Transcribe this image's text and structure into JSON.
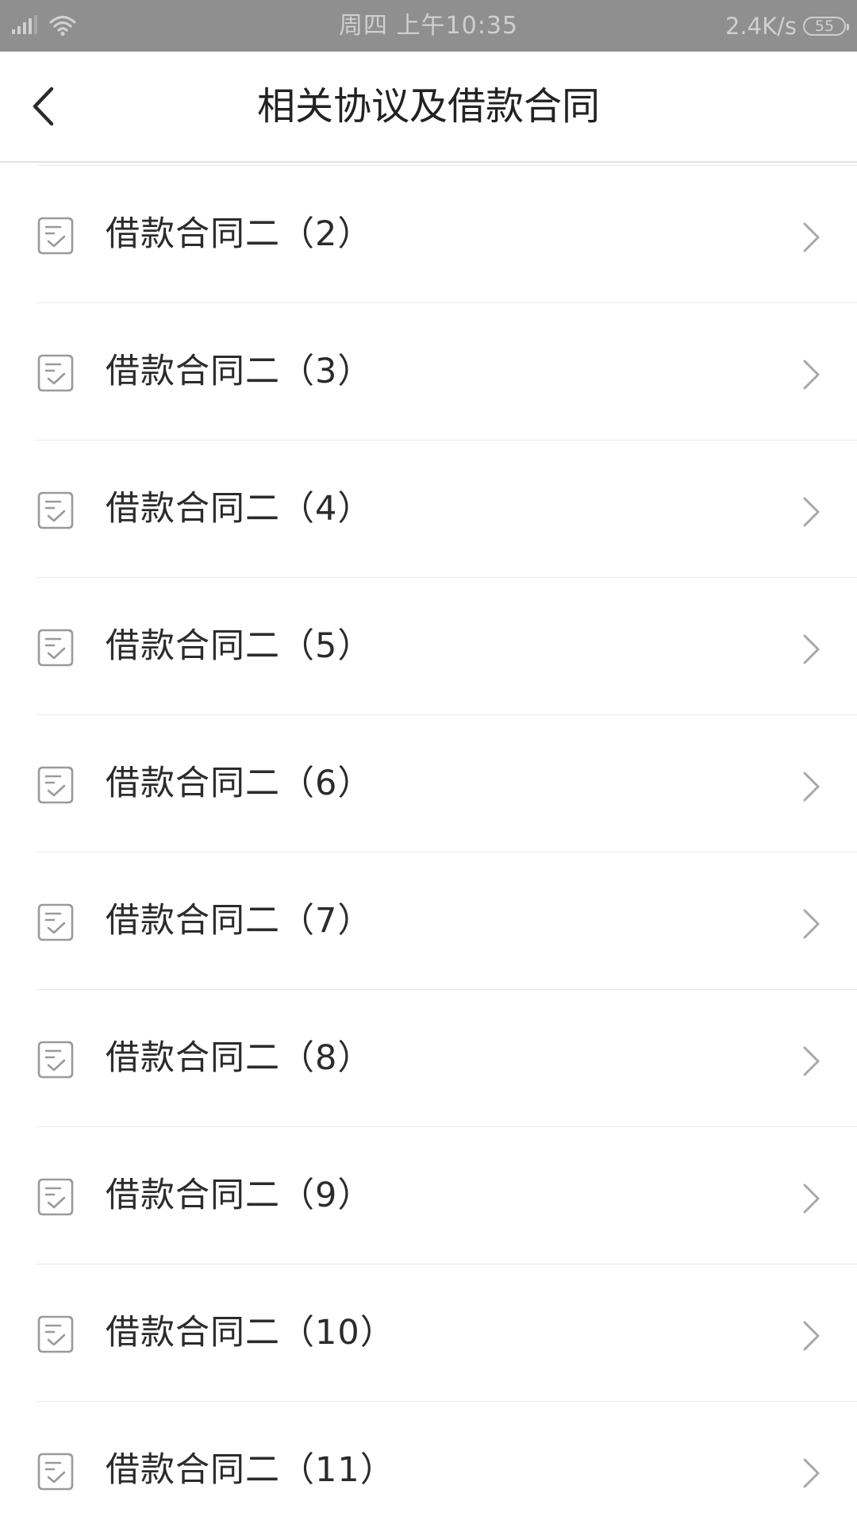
{
  "status_bar": {
    "time": "周四  上午10:35",
    "net_speed": "2.4K/s",
    "battery": "55",
    "icons": [
      "signal-icon",
      "wifi-icon",
      "battery-icon"
    ]
  },
  "header": {
    "title": "相关协议及借款合同",
    "back_icon": "chevron-left-icon"
  },
  "list": {
    "items": [
      {
        "label": "借款合同二（2）"
      },
      {
        "label": "借款合同二（3）"
      },
      {
        "label": "借款合同二（4）"
      },
      {
        "label": "借款合同二（5）"
      },
      {
        "label": "借款合同二（6）"
      },
      {
        "label": "借款合同二（7）"
      },
      {
        "label": "借款合同二（8）"
      },
      {
        "label": "借款合同二（9）"
      },
      {
        "label": "借款合同二（10）"
      },
      {
        "label": "借款合同二（11）"
      }
    ],
    "item_icon": "document-check-icon",
    "trailing_icon": "chevron-right-icon"
  },
  "colors": {
    "status_bar_bg": "#8f8f8f",
    "text": "#2b2b2b",
    "icon_gray": "#9a9a9a",
    "divider": "#e8e8e8"
  }
}
